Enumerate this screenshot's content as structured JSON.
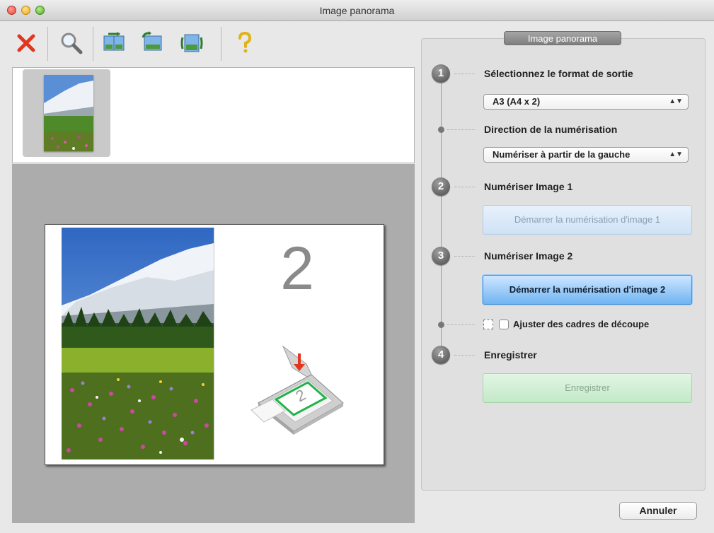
{
  "window": {
    "title": "Image panorama"
  },
  "toolbar": {
    "buttons": [
      {
        "icon": "delete-x-icon"
      },
      {
        "icon": "magnifier-icon"
      },
      {
        "icon": "swap-images-icon"
      },
      {
        "icon": "rotate-image-icon"
      },
      {
        "icon": "flip-image-icon"
      },
      {
        "icon": "help-icon"
      }
    ]
  },
  "preview": {
    "slot_number": "2"
  },
  "panel": {
    "title": "Image panorama",
    "step1": {
      "number": "1",
      "label": "Sélectionnez le format de sortie",
      "format_value": "A3 (A4 x 2)"
    },
    "direction": {
      "label": "Direction de la numérisation",
      "value": "Numériser à partir de la gauche"
    },
    "step2": {
      "number": "2",
      "label": "Numériser Image 1",
      "button": "Démarrer la numérisation d'image 1"
    },
    "step3": {
      "number": "3",
      "label": "Numériser Image 2",
      "button": "Démarrer la numérisation d'image 2"
    },
    "crop": {
      "label": "Ajuster des cadres de découpe",
      "checked": false
    },
    "step4": {
      "number": "4",
      "label": "Enregistrer",
      "button": "Enregistrer"
    }
  },
  "footer": {
    "cancel_label": "Annuler"
  },
  "colors": {
    "primary_button": "#6fb4f2",
    "save_button": "#c3e9c7",
    "delete_icon": "#e2361f"
  }
}
